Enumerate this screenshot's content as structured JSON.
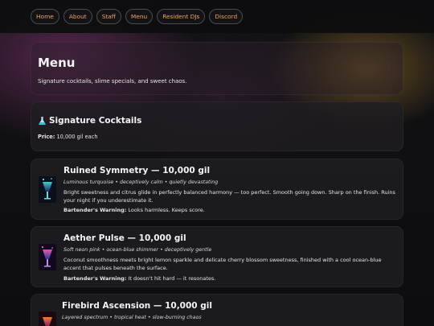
{
  "nav": {
    "items": [
      {
        "label": "Home"
      },
      {
        "label": "About"
      },
      {
        "label": "Staff"
      },
      {
        "label": "Menu"
      },
      {
        "label": "Resident DJs"
      },
      {
        "label": "Discord"
      }
    ]
  },
  "hero": {
    "title": "Menu",
    "subtitle": "Signature cocktails, slime specials, and sweet chaos."
  },
  "section": {
    "icon": "flask-icon",
    "title": "Signature Cocktails",
    "price_label": "Price:",
    "price_value": "10,000 gil each"
  },
  "drinks": [
    {
      "name": "Ruined Symmetry — 10,000 gil",
      "tagline": "Luminous turquoise • deceptively calm • quietly devastating",
      "description": "Bright sweetness and citrus glide in perfectly balanced harmony — too perfect. Smooth going down. Sharp on the finish. Ruins your night if you underestimate it.",
      "warning_label": "Bartender's Warning:",
      "warning_text": "Looks harmless. Keeps score.",
      "colors": {
        "top": "#3fd0c8",
        "bottom": "#1a2a6a"
      }
    },
    {
      "name": "Aether Pulse — 10,000 gil",
      "tagline": "Soft neon pink • ocean-blue shimmer • deceptively gentle",
      "description": "Coconut smoothness meets bright lemon sparkle and delicate cherry blossom sweetness, finished with a cool ocean-blue accent that pulses beneath the surface.",
      "warning_label": "Bartender's Warning:",
      "warning_text": "It doesn't hit hard — it resonates.",
      "colors": {
        "top": "#e05ab0",
        "bottom": "#2a3a9a"
      }
    },
    {
      "name": "Firebird Ascension — 10,000 gil",
      "tagline": "Layered spectrum • tropical heat • slow-burning chaos",
      "colors": {
        "top": "#ff7a2a",
        "bottom": "#7a1a6a"
      }
    }
  ]
}
